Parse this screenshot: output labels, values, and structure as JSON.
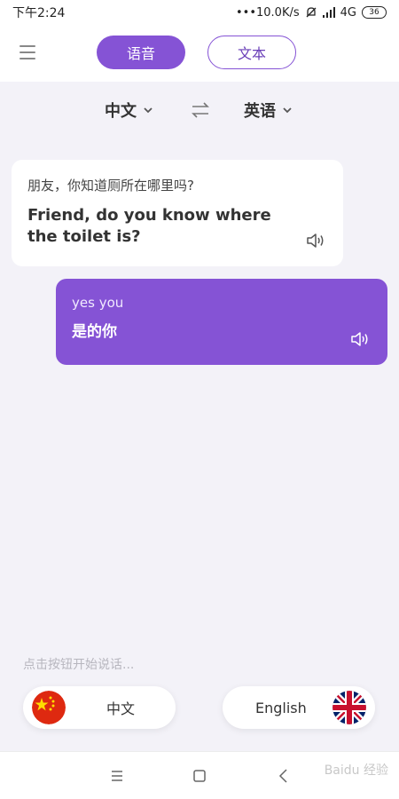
{
  "status_bar": {
    "time": "下午2:24",
    "right": "•••10.0K/s",
    "network": "4G",
    "battery": "36"
  },
  "header": {
    "tabs": [
      {
        "label": "语音",
        "active": true
      },
      {
        "label": "文本",
        "active": false
      }
    ]
  },
  "lang_bar": {
    "source": "中文",
    "target": "英语"
  },
  "messages": [
    {
      "source": "朋友，你知道厕所在哪里吗?",
      "translation": "Friend, do you know where the toilet is?"
    },
    {
      "source": "yes you",
      "translation": "是的你"
    }
  ],
  "hint": "点击按钮开始说话...",
  "buttons": {
    "chinese": "中文",
    "english": "English"
  },
  "watermark": "Baidu 经验",
  "colors": {
    "accent": "#8553d5",
    "background": "#f3f2f8"
  }
}
